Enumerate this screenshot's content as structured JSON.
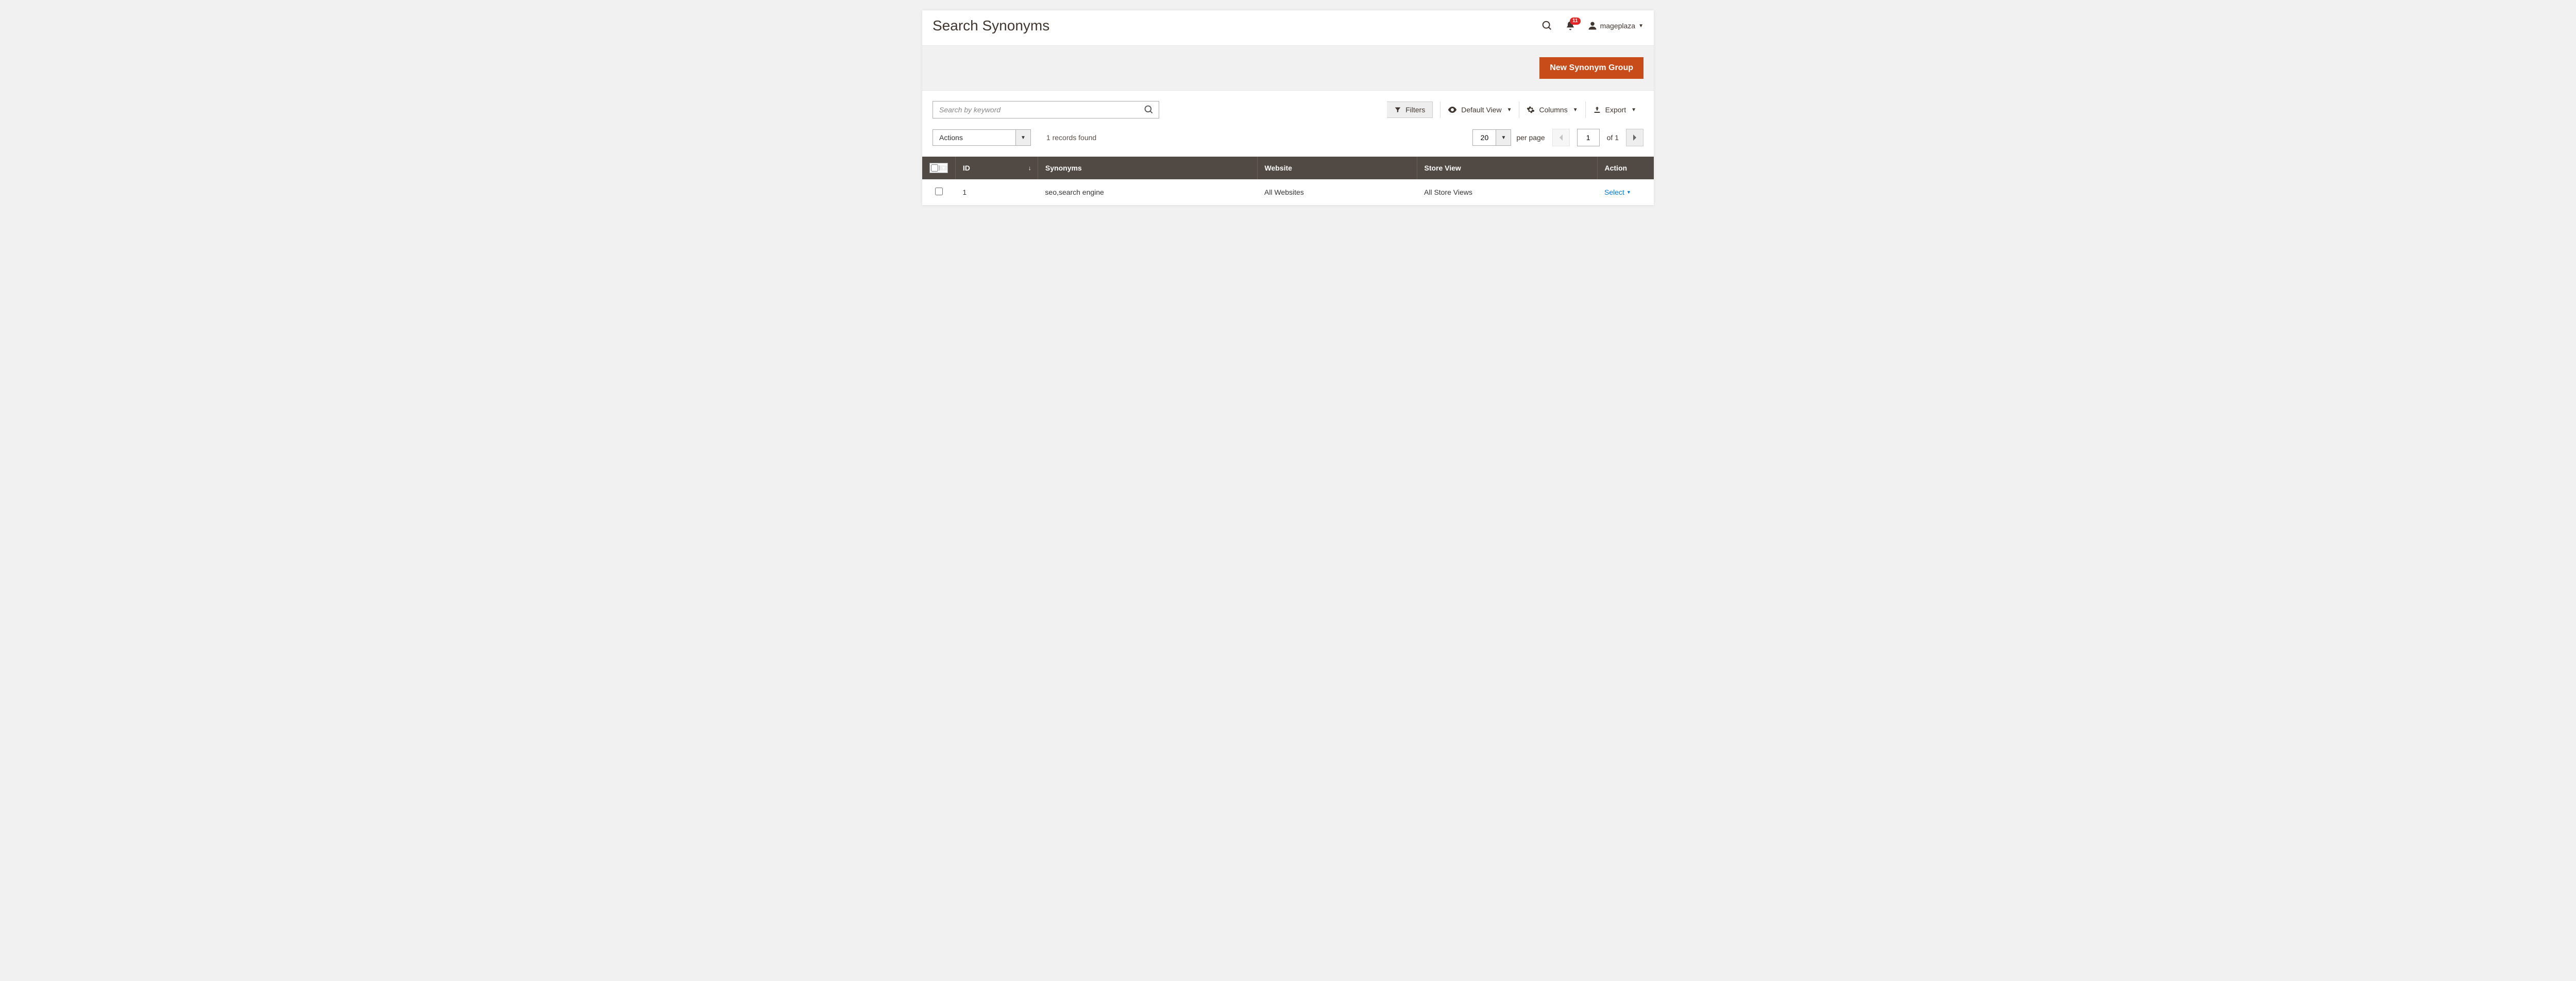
{
  "header": {
    "title": "Search Synonyms",
    "notifications_count": "11",
    "username": "mageplaza"
  },
  "action_bar": {
    "new_button": "New Synonym Group"
  },
  "toolbar": {
    "search_placeholder": "Search by keyword",
    "filters": "Filters",
    "default_view": "Default View",
    "columns": "Columns",
    "export": "Export"
  },
  "mid": {
    "actions_label": "Actions",
    "records_found": "1 records found",
    "per_page_value": "20",
    "per_page_label": "per page",
    "current_page": "1",
    "total_pages_label": "of 1"
  },
  "columns": {
    "id": "ID",
    "synonyms": "Synonyms",
    "website": "Website",
    "store_view": "Store View",
    "action": "Action"
  },
  "rows": [
    {
      "id": "1",
      "synonyms": "seo,search engine",
      "website": "All Websites",
      "store_view": "All Store Views",
      "action_label": "Select"
    }
  ]
}
